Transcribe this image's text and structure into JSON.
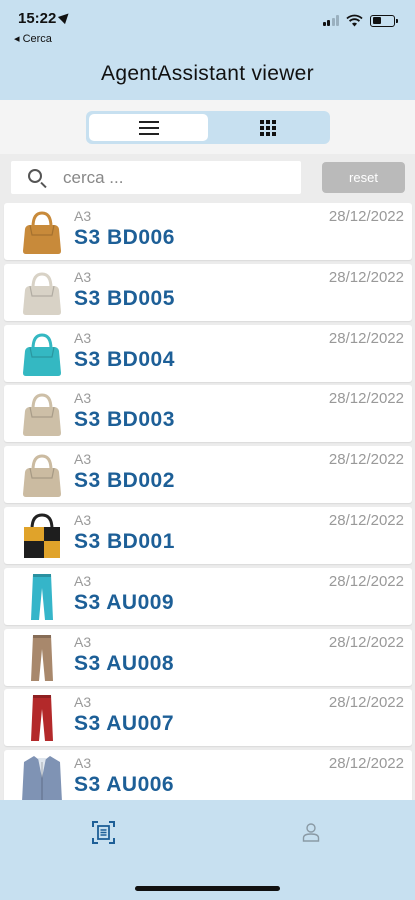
{
  "status": {
    "time": "15:22",
    "back_label": "◂ Cerca",
    "battery_level": 0.42
  },
  "header": {
    "title": "AgentAssistant viewer"
  },
  "view_switch": {
    "active": "list",
    "options": [
      "list-icon",
      "grid-icon"
    ]
  },
  "search": {
    "placeholder": "cerca ...",
    "value": "",
    "reset_label": "reset"
  },
  "colors": {
    "accent": "#c7e0f0",
    "code_text": "#1d5f97",
    "muted_text": "#9a9a9a",
    "reset_button": "#bababa"
  },
  "items": [
    {
      "category": "A3",
      "code": "S3  BD006",
      "date": "28/12/2022",
      "thumb": "bag-icon",
      "color": "#c88a3a"
    },
    {
      "category": "A3",
      "code": "S3  BD005",
      "date": "28/12/2022",
      "thumb": "bag-icon",
      "color": "#d8d2c6"
    },
    {
      "category": "A3",
      "code": "S3  BD004",
      "date": "28/12/2022",
      "thumb": "bag-icon",
      "color": "#34b8c2"
    },
    {
      "category": "A3",
      "code": "S3  BD003",
      "date": "28/12/2022",
      "thumb": "bag-icon",
      "color": "#cdbfa7"
    },
    {
      "category": "A3",
      "code": "S3  BD002",
      "date": "28/12/2022",
      "thumb": "bag-icon",
      "color": "#cbbba1"
    },
    {
      "category": "A3",
      "code": "S3  BD001",
      "date": "28/12/2022",
      "thumb": "tote-bag-icon",
      "color": "#e0a32a"
    },
    {
      "category": "A3",
      "code": "S3  AU009",
      "date": "28/12/2022",
      "thumb": "trousers-icon",
      "color": "#35b5c9"
    },
    {
      "category": "A3",
      "code": "S3  AU008",
      "date": "28/12/2022",
      "thumb": "trousers-icon",
      "color": "#a8886c"
    },
    {
      "category": "A3",
      "code": "S3  AU007",
      "date": "28/12/2022",
      "thumb": "trousers-icon",
      "color": "#b3292a"
    },
    {
      "category": "A3",
      "code": "S3  AU006",
      "date": "28/12/2022",
      "thumb": "jacket-icon",
      "color": "#7f93b4"
    }
  ],
  "tabbar": {
    "tabs": [
      {
        "icon": "scan-icon",
        "active": true
      },
      {
        "icon": "profile-icon",
        "active": false
      }
    ]
  }
}
